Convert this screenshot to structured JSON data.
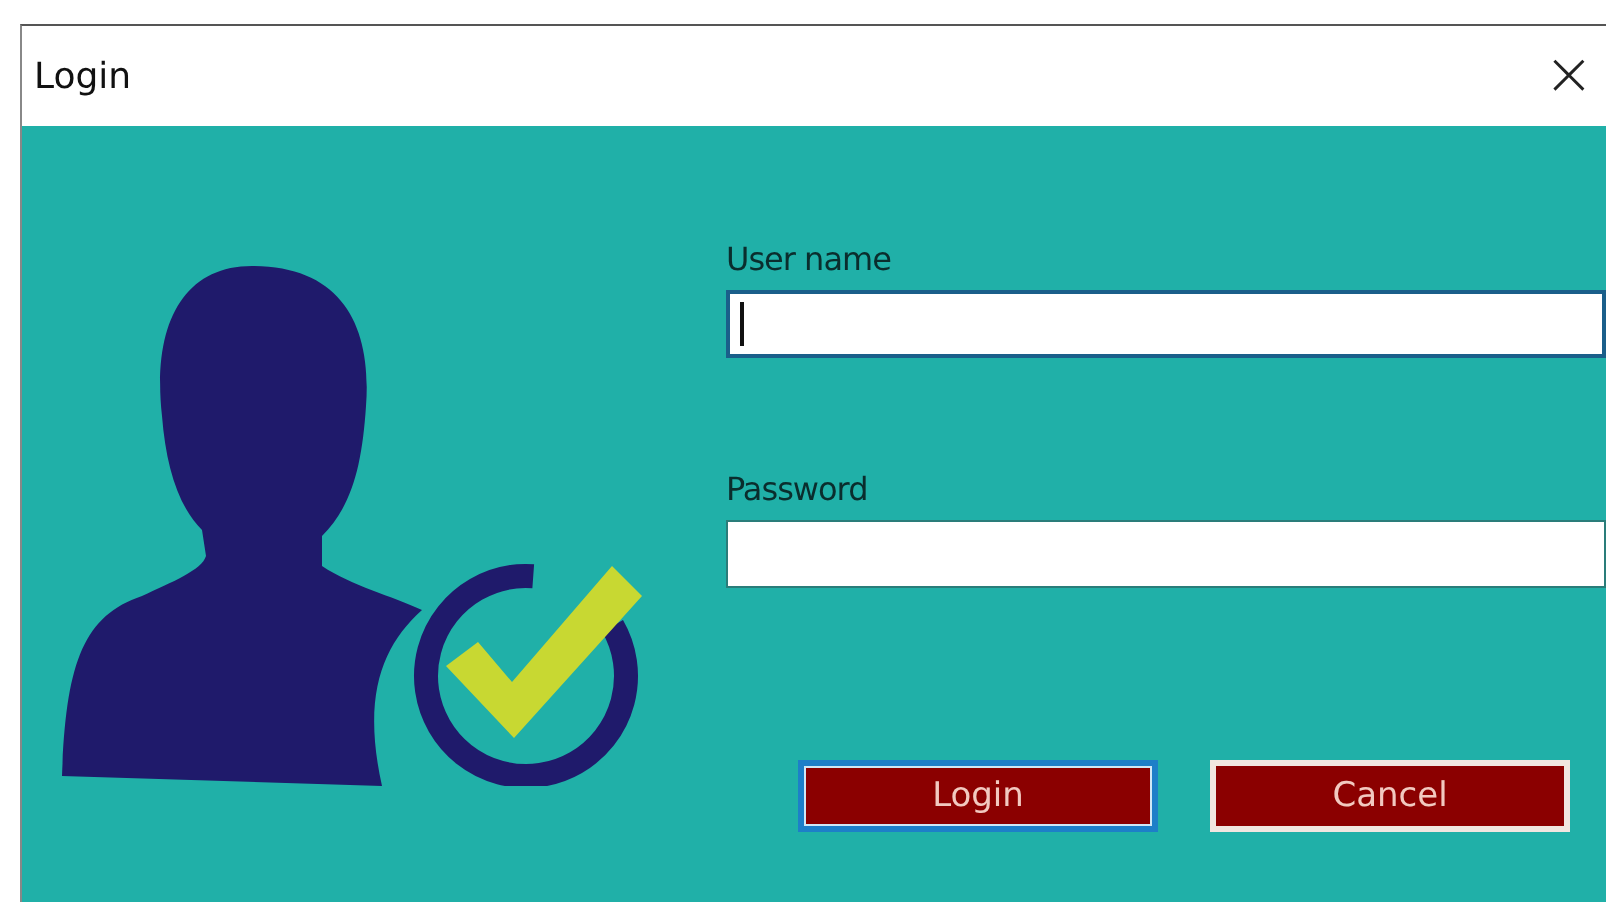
{
  "window": {
    "title": "Login",
    "close": "×"
  },
  "fields": [
    {
      "label": "User name",
      "focused": true
    },
    {
      "label": "Password",
      "focused": false
    }
  ],
  "buttons": [
    {
      "label": "Login",
      "default": true
    },
    {
      "label": "Cancel",
      "default": false
    }
  ]
}
